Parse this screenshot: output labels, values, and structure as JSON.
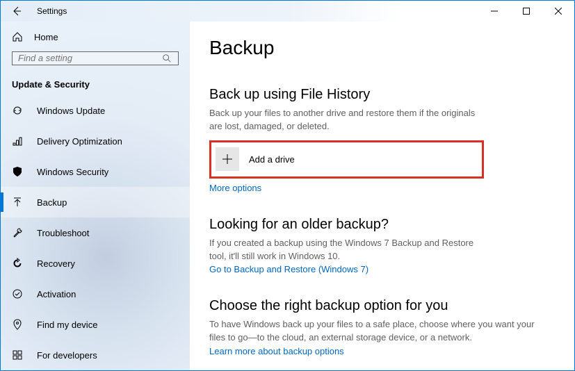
{
  "window": {
    "title": "Settings"
  },
  "sidebar": {
    "home": "Home",
    "search_placeholder": "Find a setting",
    "category": "Update & Security",
    "items": [
      {
        "label": "Windows Update"
      },
      {
        "label": "Delivery Optimization"
      },
      {
        "label": "Windows Security"
      },
      {
        "label": "Backup"
      },
      {
        "label": "Troubleshoot"
      },
      {
        "label": "Recovery"
      },
      {
        "label": "Activation"
      },
      {
        "label": "Find my device"
      },
      {
        "label": "For developers"
      }
    ]
  },
  "page": {
    "title": "Backup",
    "section1": {
      "title": "Back up using File History",
      "desc": "Back up your files to another drive and restore them if the originals are lost, damaged, or deleted.",
      "add_drive": "Add a drive",
      "more_options": "More options"
    },
    "section2": {
      "title": "Looking for an older backup?",
      "desc": "If you created a backup using the Windows 7 Backup and Restore tool, it'll still work in Windows 10.",
      "link": "Go to Backup and Restore (Windows 7)"
    },
    "section3": {
      "title": "Choose the right backup option for you",
      "desc": "To have Windows back up your files to a safe place, choose where you want your files to go—to the cloud, an external storage device, or a network.",
      "link": "Learn more about backup options"
    }
  }
}
